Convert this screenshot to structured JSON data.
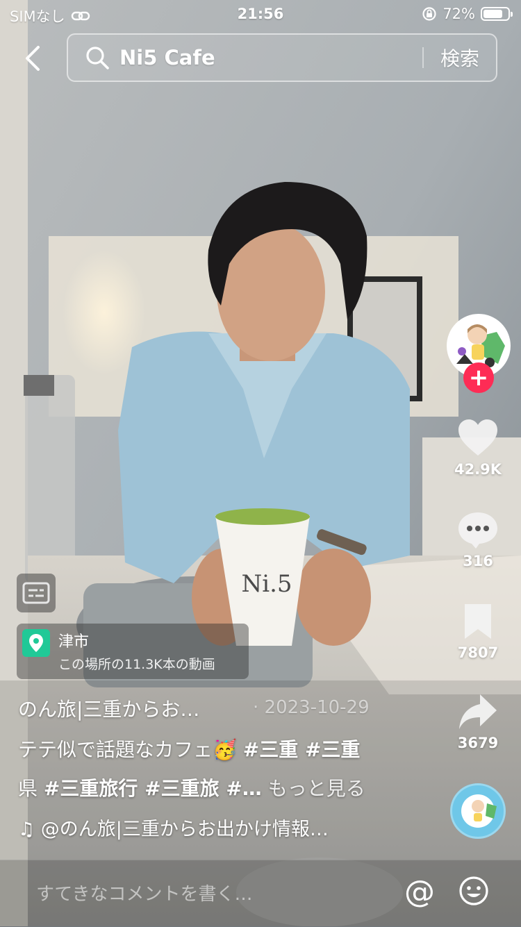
{
  "status_bar": {
    "carrier": "SIMなし",
    "time": "21:56",
    "battery": "72%",
    "battery_level": 0.72
  },
  "search": {
    "query": "Ni5 Cafe",
    "submit_label": "検索"
  },
  "actions": {
    "likes": "42.9K",
    "comments": "316",
    "saves": "7807",
    "shares": "3679"
  },
  "location": {
    "city": "津市",
    "videos": "この場所の11.3K本の動画"
  },
  "post": {
    "author": "のん旅|三重からお…",
    "date": " · 2023-10-29",
    "line1_text": "テテ似で話題なカフェ🥳 ",
    "line1_tags": "#三重 #三重",
    "line2_prefix": "県 ",
    "line2_tags": "#三重旅行 #三重旅 #…",
    "more": " もっと見る",
    "music": "♫ @のん旅|三重からお出かけ情報…"
  },
  "video": {
    "cup_text": "Ni.5"
  },
  "comment": {
    "placeholder": "すてきなコメントを書く…",
    "at_label": "@"
  },
  "icons": [
    "back-arrow-icon",
    "search-icon",
    "heart-icon",
    "comment-icon",
    "bookmark-icon",
    "share-icon",
    "caption-icon",
    "location-pin-icon",
    "emoji-icon",
    "music-note-icon"
  ],
  "colors": {
    "follow": "#fe2c55",
    "location_pin": "#20c997"
  }
}
